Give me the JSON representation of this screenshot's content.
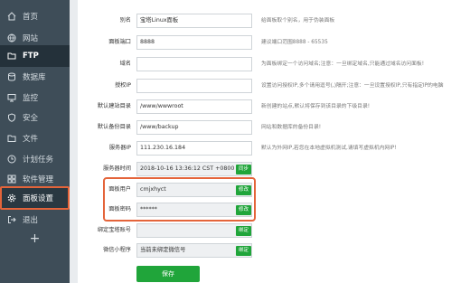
{
  "sidebar": {
    "items": [
      {
        "label": "首页",
        "icon": "home-icon"
      },
      {
        "label": "网站",
        "icon": "globe-icon"
      },
      {
        "label": "FTP",
        "icon": "ftp-icon"
      },
      {
        "label": "数据库",
        "icon": "database-icon"
      },
      {
        "label": "监控",
        "icon": "monitor-icon"
      },
      {
        "label": "安全",
        "icon": "shield-icon"
      },
      {
        "label": "文件",
        "icon": "folder-icon"
      },
      {
        "label": "计划任务",
        "icon": "clock-icon"
      },
      {
        "label": "软件管理",
        "icon": "grid-icon"
      },
      {
        "label": "面板设置",
        "icon": "gear-icon"
      },
      {
        "label": "退出",
        "icon": "logout-icon"
      }
    ],
    "add": "+"
  },
  "form": {
    "alias": {
      "label": "别名",
      "value": "宝塔Linux面板",
      "tip": "给面板取个别名，用于伪装面板"
    },
    "port": {
      "label": "面板端口",
      "value": "8888",
      "tip": "建议端口范围8888 - 65535"
    },
    "domain": {
      "label": "域名",
      "value": "",
      "tip": "为面板绑定一个访问域名;注意：一旦绑定域名,只能通过域名访问面板!"
    },
    "auth_ip": {
      "label": "授权IP",
      "value": "",
      "tip": "设置访问授权IP,多个请用逗号(,)隔开;注意：一旦设置授权IP,只有指定IP的电脑"
    },
    "site_dir": {
      "label": "默认建站目录",
      "value": "/www/wwwroot",
      "tip": "新创建的站点,默认将保存到该目录的下级目录!"
    },
    "backup_dir": {
      "label": "默认备份目录",
      "value": "/www/backup",
      "tip": "网站和数据库的备份目录!"
    },
    "server_ip": {
      "label": "服务器IP",
      "value": "111.230.16.184",
      "tip": "默认为外网IP,若您在本地虚拟机测试,请填写虚拟机内网IP!"
    },
    "server_time": {
      "label": "服务器时间",
      "value": "2018-10-16 13:36:12 CST +0800",
      "button": "同步"
    },
    "panel_user": {
      "label": "面板用户",
      "value": "cmjxhyct",
      "button": "修改"
    },
    "panel_pass": {
      "label": "面板密码",
      "value": "******",
      "button": "修改"
    },
    "bt_account": {
      "label": "绑定宝塔账号",
      "value": "",
      "button": "绑定"
    },
    "wechat": {
      "label": "微信小程序",
      "value": "当前未绑定微信号",
      "button": "绑定"
    },
    "save": "保存"
  },
  "colors": {
    "sidebar": "#3e4d58",
    "accent": "#20a53a",
    "highlight": "#e4643a"
  }
}
